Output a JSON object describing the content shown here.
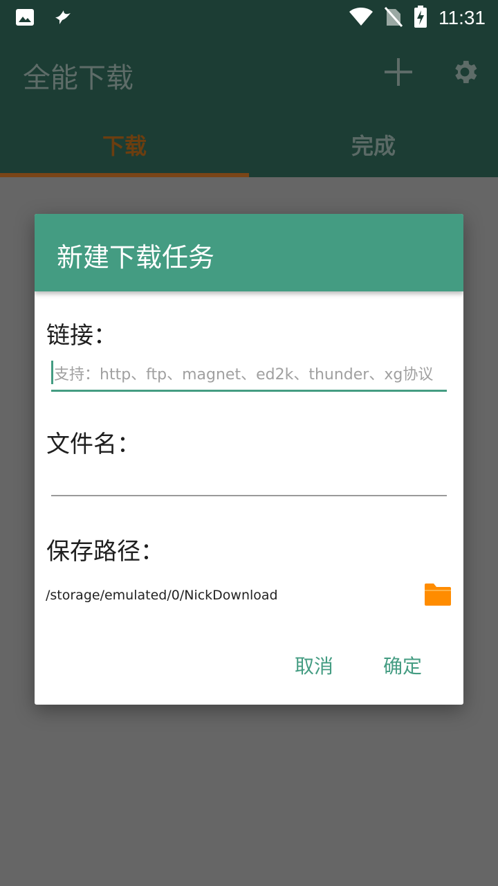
{
  "status_bar": {
    "time": "11:31",
    "icons": [
      "image-icon",
      "bird-notification-icon",
      "wifi-icon",
      "no-sim-icon",
      "battery-charging-icon"
    ]
  },
  "toolbar": {
    "title": "全能下载",
    "add_icon": "plus-icon",
    "settings_icon": "gear-icon"
  },
  "tabs": [
    {
      "label": "下载",
      "selected": true
    },
    {
      "label": "完成",
      "selected": false
    }
  ],
  "dialog": {
    "title": "新建下载任务",
    "link_label": "链接：",
    "link_placeholder": "支持：http、ftp、magnet、ed2k、thunder、xg协议",
    "link_value": "",
    "filename_label": "文件名：",
    "filename_value": "",
    "path_label": "保存路径：",
    "path_value": "/storage/emulated/0/NickDownload",
    "folder_icon": "folder-icon",
    "cancel_label": "取消",
    "ok_label": "确定"
  },
  "colors": {
    "primary_dark": "#1c3d34",
    "accent": "#449c82",
    "tab_indicator": "#7a4517",
    "folder": "#ff8c00",
    "overlay": "#666666"
  }
}
